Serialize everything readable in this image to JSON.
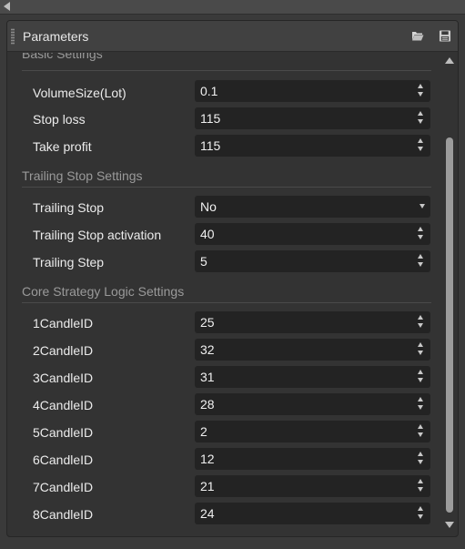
{
  "panel": {
    "title": "Parameters",
    "header_icons": [
      "folder-open-icon",
      "save-icon"
    ]
  },
  "sections": {
    "basic": {
      "title": "Basic Settings",
      "rows": [
        {
          "label": "VolumeSize(Lot)",
          "value": "0.1"
        },
        {
          "label": "Stop loss",
          "value": "115"
        },
        {
          "label": "Take profit",
          "value": "115"
        }
      ]
    },
    "trailing": {
      "title": "Trailing Stop Settings",
      "rows": [
        {
          "label": "Trailing Stop",
          "value": "No"
        },
        {
          "label": "Trailing Stop activation",
          "value": "40"
        },
        {
          "label": "Trailing Step",
          "value": "5"
        }
      ]
    },
    "core": {
      "title": "Core Strategy Logic Settings",
      "rows": [
        {
          "label": "1CandleID",
          "value": "25"
        },
        {
          "label": "2CandleID",
          "value": "32"
        },
        {
          "label": "3CandleID",
          "value": "31"
        },
        {
          "label": "4CandleID",
          "value": "28"
        },
        {
          "label": "5CandleID",
          "value": "2"
        },
        {
          "label": "6CandleID",
          "value": "12"
        },
        {
          "label": "7CandleID",
          "value": "21"
        },
        {
          "label": "8CandleID",
          "value": "24"
        }
      ]
    }
  },
  "colors": {
    "panel_bg": "#333333",
    "header_bg": "#414141",
    "field_bg": "#232323",
    "section_text": "#9a9a9a",
    "scroll_thumb": "#9c9c9c"
  }
}
